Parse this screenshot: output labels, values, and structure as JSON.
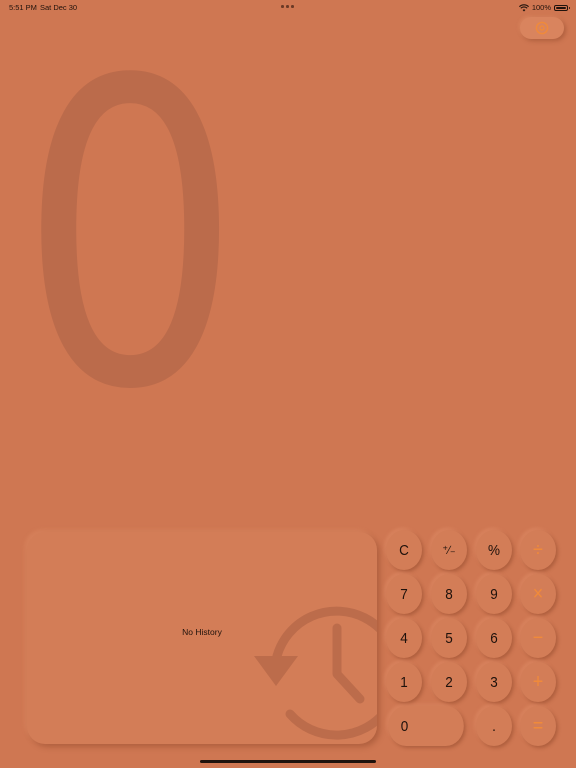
{
  "status_bar": {
    "time": "5:51 PM",
    "date": "Sat Dec 30",
    "battery": "100%"
  },
  "display": {
    "value": "0"
  },
  "history": {
    "empty_text": "No History"
  },
  "keypad": {
    "clear": "C",
    "sign": "⁺∕₋",
    "percent": "%",
    "divide": "÷",
    "seven": "7",
    "eight": "8",
    "nine": "9",
    "multiply": "×",
    "four": "4",
    "five": "5",
    "six": "6",
    "minus": "−",
    "one": "1",
    "two": "2",
    "three": "3",
    "plus": "+",
    "zero": "0",
    "decimal": ".",
    "equals": "="
  },
  "colors": {
    "background": "#cf7752",
    "accent": "#f08a3a",
    "text": "#1f120c"
  },
  "icons": {
    "settings": "gear-icon",
    "history": "clock-history-icon",
    "wifi": "wifi-icon",
    "battery": "battery-icon"
  }
}
